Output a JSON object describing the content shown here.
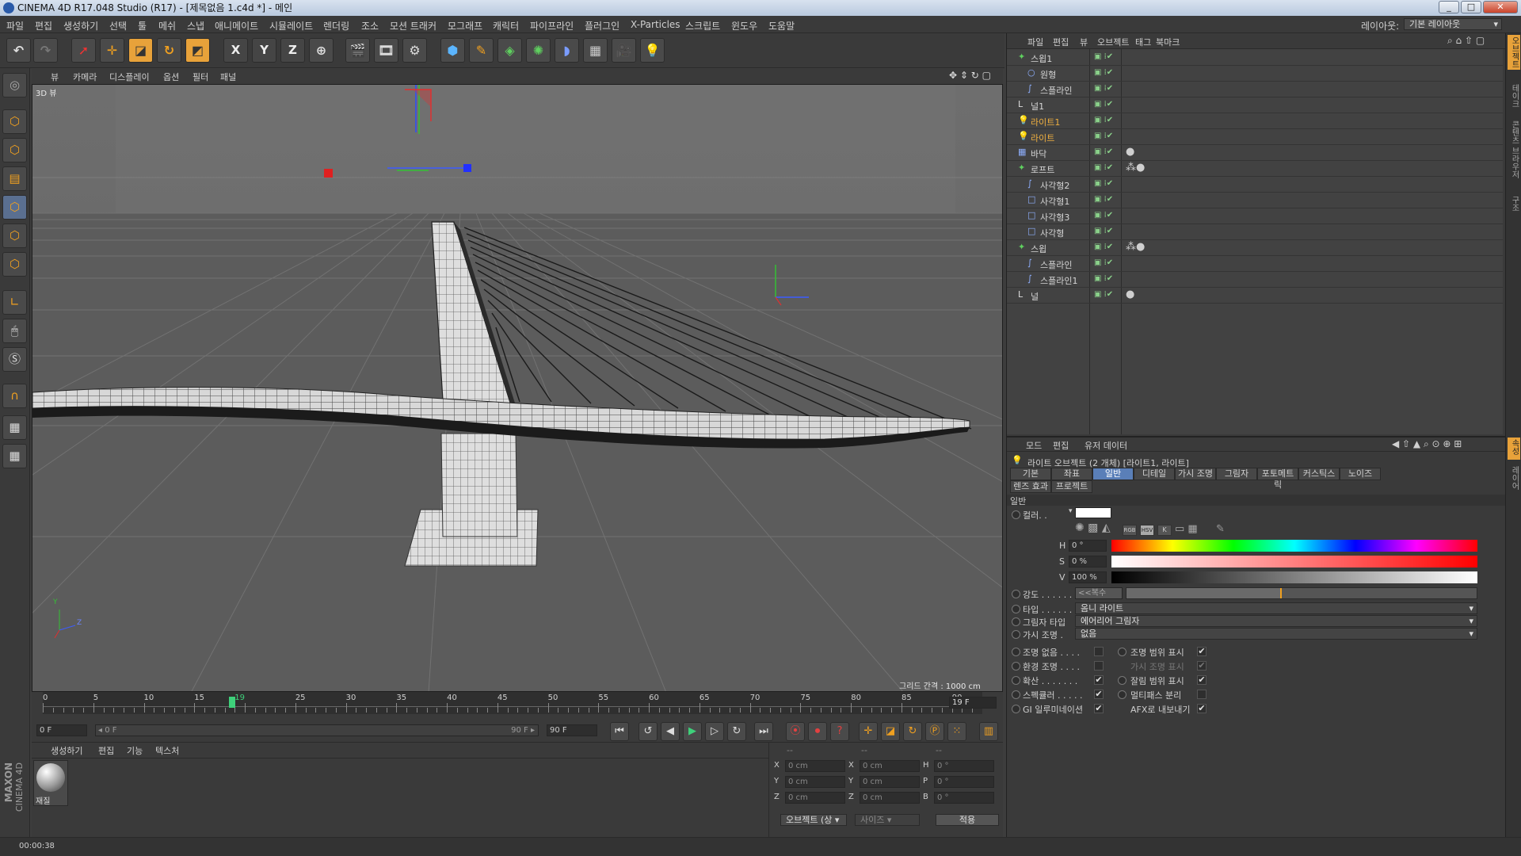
{
  "window": {
    "title": "CINEMA 4D R17.048 Studio (R17) - [제목없음 1.c4d *] - 메인",
    "min": "_",
    "max": "□",
    "close": "✕"
  },
  "menubar": {
    "items": [
      "파일",
      "편집",
      "생성하기",
      "선택",
      "툴",
      "메쉬",
      "스냅",
      "애니메이트",
      "시뮬레이트",
      "렌더링",
      "조소",
      "모션 트래커",
      "모그래프",
      "캐릭터",
      "파이프라인",
      "플러그인",
      "X-Particles",
      "스크립트",
      "윈도우",
      "도움말"
    ],
    "layout_label": "레이아웃:",
    "layout_value": "기본 레이아웃"
  },
  "toolbar": {
    "axis_x": "X",
    "axis_y": "Y",
    "axis_z": "Z"
  },
  "viewport": {
    "menu": [
      "뷰",
      "카메라",
      "디스플레이",
      "옵션",
      "필터",
      "패널"
    ],
    "label": "3D 뷰",
    "grid_spacing": "그리드 간격 : 1000 cm",
    "axis_y": "Y",
    "axis_z": "Z"
  },
  "timeline": {
    "ticks": [
      "0",
      "5",
      "10",
      "15",
      "19",
      "25",
      "30",
      "35",
      "40",
      "45",
      "50",
      "55",
      "60",
      "65",
      "70",
      "75",
      "80",
      "85",
      "90"
    ],
    "current_frame": "19 F",
    "start": "0 F",
    "range_start": "◂ 0 F",
    "range_end": "90 F ▸",
    "end": "90 F"
  },
  "material_panel": {
    "menu": [
      "생성하기",
      "편집",
      "기능",
      "텍스처"
    ],
    "material_name": "재질"
  },
  "coord_panel": {
    "headers": [
      "--",
      "--",
      "--"
    ],
    "rows": [
      {
        "a": "X",
        "av": "0 cm",
        "b": "X",
        "bv": "0 cm",
        "c": "H",
        "cv": "0 °"
      },
      {
        "a": "Y",
        "av": "0 cm",
        "b": "Y",
        "bv": "0 cm",
        "c": "P",
        "cv": "0 °"
      },
      {
        "a": "Z",
        "av": "0 cm",
        "b": "Z",
        "bv": "0 cm",
        "c": "B",
        "cv": "0 °"
      }
    ],
    "mode": "오브젝트 (상",
    "size": "사이즈",
    "apply": "적용"
  },
  "status": {
    "time": "00:00:38",
    "brand1": "MAXON",
    "brand2": "CINEMA 4D"
  },
  "object_manager": {
    "menu": [
      "파일",
      "편집",
      "뷰",
      "오브젝트",
      "태그",
      "북마크"
    ],
    "objects": [
      {
        "name": "스윕1",
        "indent": 0,
        "hl": false
      },
      {
        "name": "원형",
        "indent": 1,
        "hl": false
      },
      {
        "name": "스플라인",
        "indent": 1,
        "hl": false
      },
      {
        "name": "널1",
        "indent": 0,
        "hl": false
      },
      {
        "name": "라이트1",
        "indent": 0,
        "hl": true
      },
      {
        "name": "라이트",
        "indent": 0,
        "hl": true
      },
      {
        "name": "바닥",
        "indent": 0,
        "hl": false
      },
      {
        "name": "로프트",
        "indent": 0,
        "hl": false
      },
      {
        "name": "사각형2",
        "indent": 1,
        "hl": false
      },
      {
        "name": "사각형1",
        "indent": 1,
        "hl": false
      },
      {
        "name": "사각형3",
        "indent": 1,
        "hl": false
      },
      {
        "name": "사각형",
        "indent": 1,
        "hl": false
      },
      {
        "name": "스윕",
        "indent": 0,
        "hl": false
      },
      {
        "name": "스플라인",
        "indent": 1,
        "hl": false
      },
      {
        "name": "스플라인1",
        "indent": 1,
        "hl": false
      },
      {
        "name": "널",
        "indent": 0,
        "hl": false
      }
    ]
  },
  "attribute_manager": {
    "menu": [
      "모드",
      "편집",
      "유저 데이터"
    ],
    "header": "라이트 오브젝트 (2 개체) [라이트1, 라이트]",
    "tabs_row1": [
      "기본",
      "좌표",
      "일반",
      "디테일",
      "가시 조명",
      "그림자",
      "포토메트릭",
      "커스틱스",
      "노이즈"
    ],
    "tabs_row2": [
      "렌즈 효과",
      "프로젝트"
    ],
    "section": "일반",
    "color_label": "컬러. .",
    "color_modes": [
      "RGB",
      "HSV",
      "K"
    ],
    "h_label": "H",
    "h_value": "0 °",
    "s_label": "S",
    "s_value": "0 %",
    "v_label": "V",
    "v_value": "100 %",
    "intensity_label": "강도 . . . . . .",
    "intensity_value": "<<복수",
    "type_label": "타입 . . . . . .",
    "type_value": "옴니 라이트",
    "shadow_label": "그림자 타입",
    "shadow_value": "에어리어 그림자",
    "visible_label": "가시 조명 .",
    "visible_value": "없음",
    "checks_left": [
      "조명 없음 . . . .",
      "환경 조명 . . . .",
      "확산 . . . . . . .",
      "스펙큘러 . . . . .",
      "GI 일루미네이션"
    ],
    "checks_right": [
      "조명 범위 표시",
      "가시 조명 표시",
      "잘림 범위 표시",
      "멀티패스 분리",
      "AFX로 내보내기"
    ],
    "checks_left_state": [
      false,
      false,
      true,
      true,
      true
    ],
    "checks_right_state": [
      true,
      true,
      true,
      false,
      true
    ]
  },
  "right_strip": [
    "오브젝트",
    "테이크",
    "콘텐츠 브라우저",
    "구조"
  ],
  "right_strip_lower": [
    "속성",
    "레이어"
  ],
  "colors": {
    "accent": "#e8a23a",
    "selected_tab": "#5a7fb8",
    "object_highlight": "#f0b040"
  }
}
